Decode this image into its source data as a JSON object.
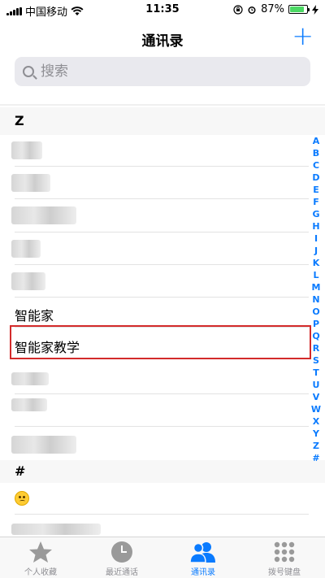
{
  "status_bar": {
    "carrier": "中国移动",
    "time": "11:35",
    "battery_percent": "87%",
    "battery_level": 0.87
  },
  "nav": {
    "title": "通讯录",
    "add_label": "+"
  },
  "search": {
    "placeholder": "搜索"
  },
  "sections": [
    {
      "letter": "Z"
    },
    {
      "letter": "#"
    }
  ],
  "contacts": {
    "zhinengjia": "智能家",
    "zhinengjia_jiaoxue": "智能家教学"
  },
  "index_letters": [
    "A",
    "B",
    "C",
    "D",
    "E",
    "F",
    "G",
    "H",
    "I",
    "J",
    "K",
    "L",
    "M",
    "N",
    "O",
    "P",
    "Q",
    "R",
    "S",
    "T",
    "U",
    "V",
    "W",
    "X",
    "Y",
    "Z",
    "#"
  ],
  "tabs": [
    {
      "label": "个人收藏",
      "icon": "star-icon"
    },
    {
      "label": "最近通话",
      "icon": "clock-icon"
    },
    {
      "label": "通讯录",
      "icon": "contacts-icon"
    },
    {
      "label": "拨号键盘",
      "icon": "keypad-icon"
    }
  ],
  "colors": {
    "accent": "#0a7bff",
    "highlight_border": "#d32b2b",
    "battery_fill": "#4cd964"
  }
}
